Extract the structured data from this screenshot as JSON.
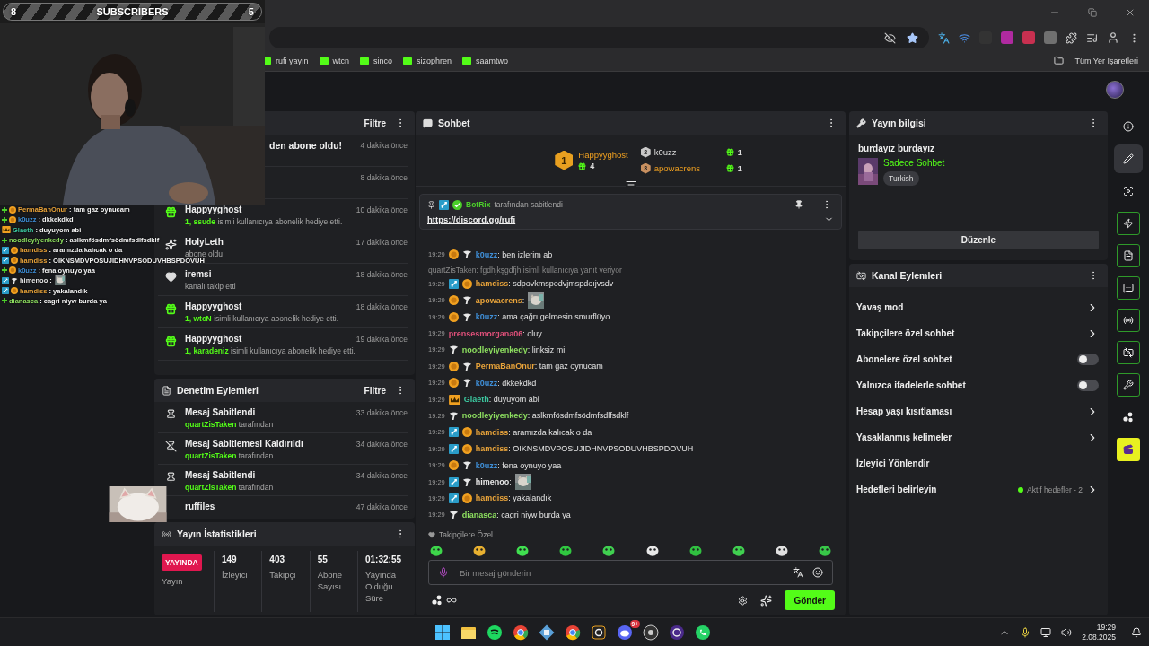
{
  "overlay": {
    "left_count": "8",
    "title": "SUBSCRIBERS",
    "right_count": "5",
    "chat": [
      {
        "badges": [
          {
            "kind": "plus"
          },
          {
            "kind": "sub"
          }
        ],
        "user": "PermaBanOnur",
        "color": "#e8a33a",
        "text": " : tam gaz oynucam"
      },
      {
        "badges": [
          {
            "kind": "plus"
          },
          {
            "kind": "sub"
          }
        ],
        "user": "k0uzz",
        "color": "#3f8fd8",
        "text": " : dkkekdkd"
      },
      {
        "badges": [
          {
            "kind": "founder"
          }
        ],
        "user": "Glaeth",
        "color": "#3cc8a0",
        "text": " : duyuyom abi"
      },
      {
        "badges": [
          {
            "kind": "plus"
          }
        ],
        "user": "noodleyiyenkedy",
        "color": "#8ee060",
        "text": " : aslkmfösdmfsödmfsdlfsdklf"
      },
      {
        "badges": [
          {
            "kind": "moderator"
          },
          {
            "kind": "sub"
          }
        ],
        "user": "hamdiss",
        "color": "#e8a33a",
        "text": " : aramızda kalıcak o da"
      },
      {
        "badges": [
          {
            "kind": "moderator"
          },
          {
            "kind": "sub"
          }
        ],
        "user": "hamdiss",
        "color": "#e8a33a",
        "text": " : OIKNSMDVPOSUJIDHNVPSODUVHBSPDOVUH"
      },
      {
        "badges": [
          {
            "kind": "plus"
          },
          {
            "kind": "sub"
          }
        ],
        "user": "k0uzz",
        "color": "#3f8fd8",
        "text": " : fena oynuyo yaa"
      },
      {
        "badges": [
          {
            "kind": "moderator"
          },
          {
            "kind": "gifter"
          }
        ],
        "user": "himenoo",
        "color": "#e8e8e8",
        "text": " :",
        "kind": "emote"
      },
      {
        "badges": [
          {
            "kind": "moderator"
          },
          {
            "kind": "sub"
          }
        ],
        "user": "hamdiss",
        "color": "#e8a33a",
        "text": " : yakalandık"
      },
      {
        "badges": [
          {
            "kind": "plus"
          }
        ],
        "user": "dianasca",
        "color": "#8ee060",
        "text": " : cagri niyw burda ya"
      }
    ]
  },
  "browser": {
    "bookmarks": [
      "rufi yayın",
      "wtcn",
      "sinco",
      "sizophren",
      "saamtwo"
    ],
    "all_bookmarks": "Tüm Yer İşaretleri"
  },
  "activity": {
    "filter": "Filtre",
    "items": [
      {
        "kind": "partial_text",
        "title": "den abone oldu!",
        "time": "4 dakika önce"
      },
      {
        "kind": "partial",
        "time": "8 dakika önce"
      },
      {
        "kind": "gift",
        "title": "Happyyghost",
        "highlight": "1, ssude",
        "text": " isimli kullanıcıya abonelik hediye etti.",
        "time": "10 dakika önce"
      },
      {
        "kind": "sub",
        "title": "HolyLeth",
        "text": "abone oldu",
        "time": "17 dakika önce"
      },
      {
        "kind": "follow",
        "title": "iremsi",
        "text": "kanalı takip etti",
        "time": "18 dakika önce"
      },
      {
        "kind": "gift",
        "title": "Happyyghost",
        "highlight": "1, wtcN",
        "text": " isimli kullanıcıya abonelik hediye etti.",
        "time": "18 dakika önce"
      },
      {
        "kind": "gift",
        "title": "Happyyghost",
        "highlight": "1, karadeniz",
        "text": " isimli kullanıcıya abonelik hediye etti.",
        "time": "19 dakika önce"
      }
    ]
  },
  "moderation": {
    "title": "Denetim Eylemleri",
    "filter": "Filtre",
    "items": [
      {
        "kind": "pin",
        "title": "Mesaj Sabitlendi",
        "highlight": "quartZisTaken",
        "text": " tarafından",
        "time": "33 dakika önce"
      },
      {
        "kind": "unpin",
        "title": "Mesaj Sabitlemesi Kaldırıldı",
        "highlight": "quartZisTaken",
        "text": " tarafından",
        "time": "34 dakika önce"
      },
      {
        "kind": "pin",
        "title": "Mesaj Sabitlendi",
        "highlight": "quartZisTaken",
        "text": " tarafından",
        "time": "34 dakika önce"
      },
      {
        "kind": "covered",
        "title": "ruffiles",
        "time": "47 dakika önce"
      }
    ]
  },
  "stats": {
    "title": "Yayın İstatistikleri",
    "live": "YAYINDA",
    "live_label": "Yayın",
    "items": [
      {
        "value": "149",
        "label": "İzleyici"
      },
      {
        "value": "403",
        "label": "Takipçi"
      },
      {
        "value": "55",
        "label": "Abone Sayısı"
      },
      {
        "value": "01:32:55",
        "label": "Yayında Olduğu Süre"
      }
    ]
  },
  "chat": {
    "title": "Sohbet",
    "leaderboard": [
      {
        "rank": "1",
        "user": "Happyyghost",
        "gifts": "4"
      },
      {
        "rank": "2",
        "user": "k0uzz",
        "gifts": "1"
      },
      {
        "rank": "3",
        "user": "apowacrens",
        "gifts": "1"
      }
    ],
    "pinned": {
      "user": "BotRix",
      "text": "tarafından sabitlendi",
      "link": "https://discord.gg/rufi"
    },
    "messages": [
      {
        "time": "19:29",
        "badges": [
          {
            "kind": "sub"
          },
          {
            "kind": "gifter"
          }
        ],
        "user": "k0uzz",
        "color": "#3f8fd8",
        "text": ": ben izlerim ab"
      },
      {
        "time": "19:29",
        "badges": [
          {
            "kind": "moderator"
          },
          {
            "kind": "sub"
          }
        ],
        "user": "hamdiss",
        "color": "#e8a33a",
        "text": ": sdpovkmspodvjmspdoıjvsdv",
        "reply_to": "quartZisTaken: fgdhjkşgdfjh isimli kullanıcıya yanıt veriyor"
      },
      {
        "time": "19:29",
        "badges": [
          {
            "kind": "sub"
          },
          {
            "kind": "gifter"
          }
        ],
        "user": "apowacrens",
        "color": "#e8a33a",
        "text": ":",
        "kind": "emote"
      },
      {
        "time": "19:29",
        "badges": [
          {
            "kind": "sub"
          },
          {
            "kind": "gifter"
          }
        ],
        "user": "k0uzz",
        "color": "#3f8fd8",
        "text": ": ama çağrı gelmesin smurflüyo"
      },
      {
        "time": "19:29",
        "user": "prensesmorgana06",
        "color": "#e0507a",
        "text": ": oluy"
      },
      {
        "time": "19:29",
        "badges": [
          {
            "kind": "gifter"
          }
        ],
        "user": "noodleyiyenkedy",
        "color": "#8ee060",
        "text": ": linksiz mi"
      },
      {
        "time": "19:29",
        "badges": [
          {
            "kind": "sub"
          },
          {
            "kind": "gifter"
          }
        ],
        "user": "PermaBanOnur",
        "color": "#e8a33a",
        "text": ": tam gaz oynucam"
      },
      {
        "time": "19:29",
        "badges": [
          {
            "kind": "sub"
          },
          {
            "kind": "gifter"
          }
        ],
        "user": "k0uzz",
        "color": "#3f8fd8",
        "text": ": dkkekdkd"
      },
      {
        "time": "19:29",
        "badges": [
          {
            "kind": "founder"
          }
        ],
        "user": "Glaeth",
        "color": "#3cc8a0",
        "text": ": duyuyom abi"
      },
      {
        "time": "19:29",
        "badges": [
          {
            "kind": "gifter"
          }
        ],
        "user": "noodleyiyenkedy",
        "color": "#8ee060",
        "text": ": aslkmfösdmfsödmfsdlfsdklf"
      },
      {
        "time": "19:29",
        "badges": [
          {
            "kind": "moderator"
          },
          {
            "kind": "sub"
          }
        ],
        "user": "hamdiss",
        "color": "#e8a33a",
        "text": ": aramızda kalıcak o da"
      },
      {
        "time": "19:29",
        "badges": [
          {
            "kind": "moderator"
          },
          {
            "kind": "sub"
          }
        ],
        "user": "hamdiss",
        "color": "#e8a33a",
        "text": ": OIKNSMDVPOSUJIDHNVPSODUVHBSPDOVUH"
      },
      {
        "time": "19:29",
        "badges": [
          {
            "kind": "sub"
          },
          {
            "kind": "gifter"
          }
        ],
        "user": "k0uzz",
        "color": "#3f8fd8",
        "text": ": fena oynuyo yaa"
      },
      {
        "time": "19:29",
        "badges": [
          {
            "kind": "moderator"
          },
          {
            "kind": "gifter"
          }
        ],
        "user": "himenoo",
        "color": "#e8e8e8",
        "text": ":",
        "kind": "emote"
      },
      {
        "time": "19:29",
        "badges": [
          {
            "kind": "moderator"
          },
          {
            "kind": "sub"
          }
        ],
        "user": "hamdiss",
        "color": "#e8a33a",
        "text": ": yakalandık"
      },
      {
        "time": "19:29",
        "badges": [
          {
            "kind": "gifter"
          }
        ],
        "user": "dianasca",
        "color": "#8ee060",
        "text": ": cagri niyw burda ya"
      }
    ],
    "emote_section": "Takipçilere Özel",
    "input": {
      "placeholder": "Bir mesaj gönderin"
    },
    "send": "Gönder"
  },
  "stream_info": {
    "title": "Yayın bilgisi",
    "stream_title": "burdayız burdayız",
    "category": "Sadece Sohbet",
    "tag": "Turkish",
    "edit": "Düzenle"
  },
  "channel_actions": {
    "title": "Kanal Eylemleri",
    "items": [
      {
        "kind": "link",
        "label": "Yavaş mod"
      },
      {
        "kind": "link",
        "label": "Takipçilere özel sohbet"
      },
      {
        "kind": "toggle",
        "label": "Abonelere özel sohbet",
        "on": false
      },
      {
        "kind": "toggle",
        "label": "Yalnızca ifadelerle sohbet",
        "on": false
      },
      {
        "kind": "link",
        "label": "Hesap yaşı kısıtlaması"
      },
      {
        "kind": "link",
        "label": "Yasaklanmış kelimeler"
      },
      {
        "kind": "plain",
        "label": "İzleyici Yönlendir"
      },
      {
        "kind": "status",
        "label": "Hedefleri belirleyin",
        "status": "Aktif hedefler - 2"
      }
    ]
  },
  "rail": [
    {
      "kind": "plain",
      "selected": false
    },
    {
      "kind": "plain",
      "selected": true
    },
    {
      "kind": "plain",
      "selected": false
    },
    {
      "kind": "outlined",
      "selected": false
    },
    {
      "kind": "outlined",
      "selected": false
    },
    {
      "kind": "outlined",
      "selected": false
    },
    {
      "kind": "outlined",
      "selected": false
    },
    {
      "kind": "outlined",
      "selected": false
    },
    {
      "kind": "outlined",
      "selected": false
    },
    {
      "kind": "plain",
      "selected": false
    },
    {
      "kind": "accent",
      "selected": false
    }
  ],
  "taskbar": {
    "badge": "9+",
    "time": "19:29",
    "date": "2.08.2025"
  }
}
